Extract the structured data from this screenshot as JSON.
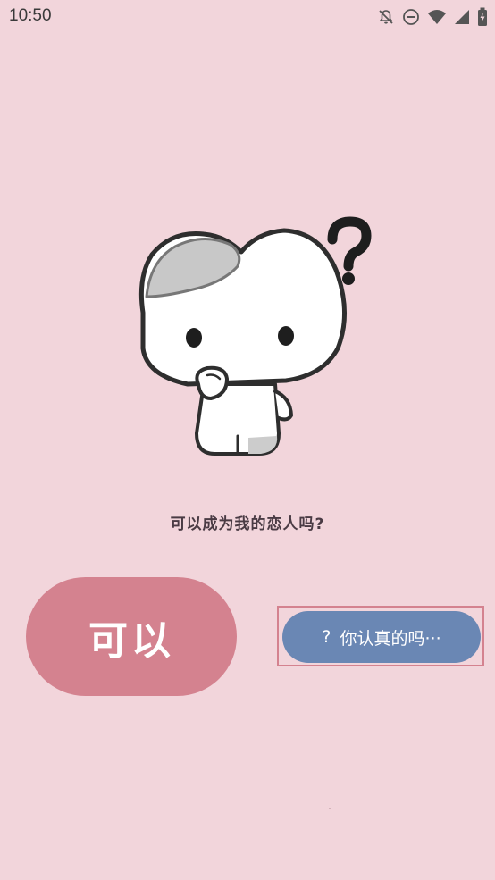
{
  "status_bar": {
    "time": "10:50",
    "icons": [
      "notifications-off-icon",
      "do-not-disturb-icon",
      "wifi-icon",
      "signal-icon",
      "battery-charging-icon"
    ]
  },
  "main": {
    "question": "可以成为我的恋人吗?",
    "yes_label": "可以",
    "serious_prefix": "?",
    "serious_label": "你认真的吗···"
  },
  "colors": {
    "background": "#f2d5db",
    "yes_button": "#d4828f",
    "serious_button": "#6a87b4",
    "highlight_border": "#d4828f"
  }
}
